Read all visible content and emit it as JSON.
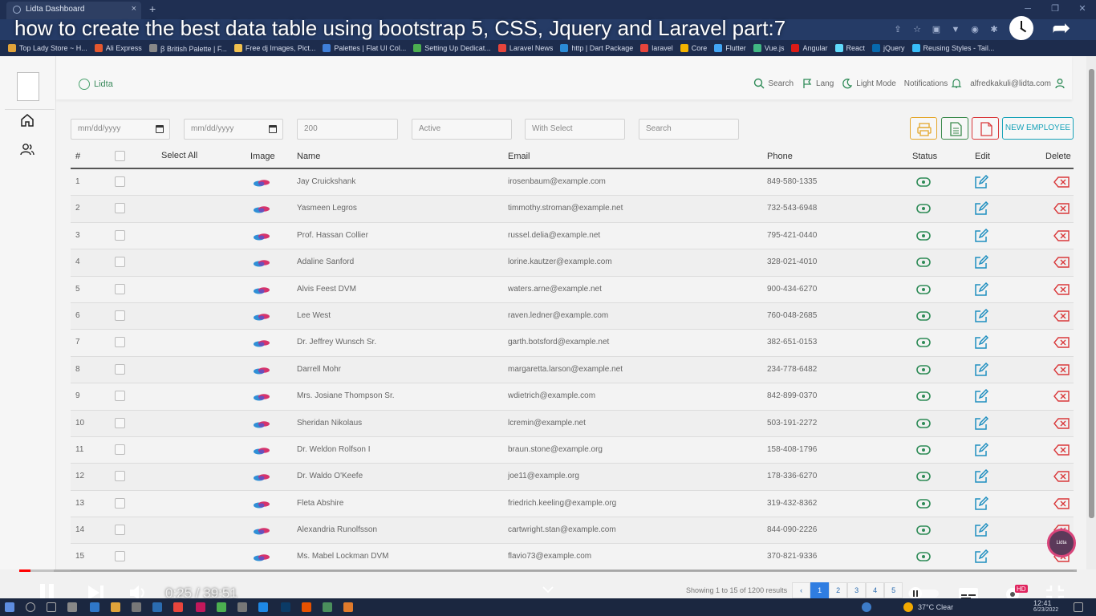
{
  "browser": {
    "tab_title": "Lidta Dashboard",
    "tab_close": "×",
    "new_tab": "+",
    "bookmarks": [
      {
        "label": "Top Lady Store ~ H...",
        "color": "#e1a33a"
      },
      {
        "label": "Ali Express",
        "color": "#e4572e"
      },
      {
        "label": "ꞵ British Palette | F...",
        "color": "#888888"
      },
      {
        "label": "Free dj Images, Pict...",
        "color": "#f2c14e"
      },
      {
        "label": "Palettes | Flat UI Col...",
        "color": "#3f7fd9"
      },
      {
        "label": "Setting Up Dedicat...",
        "color": "#4caf50"
      },
      {
        "label": "Laravel News",
        "color": "#e8453c"
      },
      {
        "label": "http | Dart Package",
        "color": "#2b8bd6"
      },
      {
        "label": "laravel",
        "color": "#e8453c"
      },
      {
        "label": "Core",
        "color": "#f4b400"
      },
      {
        "label": "Flutter",
        "color": "#42a5f5"
      },
      {
        "label": "Vue.js",
        "color": "#41b883"
      },
      {
        "label": "Angular",
        "color": "#dd1b16"
      },
      {
        "label": "React",
        "color": "#61dafb"
      },
      {
        "label": "jQuery",
        "color": "#0769ad"
      },
      {
        "label": "Reusing Styles - Tail...",
        "color": "#38bdf8"
      }
    ]
  },
  "video": {
    "title": "how to create the best data table using bootstrap 5, CSS, Jquery and Laravel part:7",
    "time": "0:25 / 39:51",
    "progress_played": 0.011,
    "progress_loaded": 0.033
  },
  "nav": {
    "brand": "Lidta",
    "search": "Search",
    "lang": "Lang",
    "light_mode": "Light Mode",
    "notifications": "Notifications",
    "email": "alfredkakuli@lidta.com"
  },
  "filters": {
    "date_from": "mm/dd/yyyy",
    "date_to": "mm/dd/yyyy",
    "per_page": "200",
    "status": "Active",
    "select": "With Select",
    "search": "Search",
    "new_employee": "NEW EMPLOYEE"
  },
  "table": {
    "headers": {
      "num": "#",
      "select_all": "Select All",
      "image": "Image",
      "name": "Name",
      "email": "Email",
      "phone": "Phone",
      "status": "Status",
      "edit": "Edit",
      "delete": "Delete"
    },
    "rows": [
      {
        "num": "1",
        "name": "Jay Cruickshank",
        "email": "irosenbaum@example.com",
        "phone": "849-580-1335"
      },
      {
        "num": "2",
        "name": "Yasmeen Legros",
        "email": "timmothy.stroman@example.net",
        "phone": "732-543-6948"
      },
      {
        "num": "3",
        "name": "Prof. Hassan Collier",
        "email": "russel.delia@example.net",
        "phone": "795-421-0440"
      },
      {
        "num": "4",
        "name": "Adaline Sanford",
        "email": "lorine.kautzer@example.com",
        "phone": "328-021-4010"
      },
      {
        "num": "5",
        "name": "Alvis Feest DVM",
        "email": "waters.arne@example.net",
        "phone": "900-434-6270"
      },
      {
        "num": "6",
        "name": "Lee West",
        "email": "raven.ledner@example.com",
        "phone": "760-048-2685"
      },
      {
        "num": "7",
        "name": "Dr. Jeffrey Wunsch Sr.",
        "email": "garth.botsford@example.net",
        "phone": "382-651-0153"
      },
      {
        "num": "8",
        "name": "Darrell Mohr",
        "email": "margaretta.larson@example.net",
        "phone": "234-778-6482"
      },
      {
        "num": "9",
        "name": "Mrs. Josiane Thompson Sr.",
        "email": "wdietrich@example.com",
        "phone": "842-899-0370"
      },
      {
        "num": "10",
        "name": "Sheridan Nikolaus",
        "email": "lcremin@example.net",
        "phone": "503-191-2272"
      },
      {
        "num": "11",
        "name": "Dr. Weldon Rolfson I",
        "email": "braun.stone@example.org",
        "phone": "158-408-1796"
      },
      {
        "num": "12",
        "name": "Dr. Waldo O'Keefe",
        "email": "joe11@example.org",
        "phone": "178-336-6270"
      },
      {
        "num": "13",
        "name": "Fleta Abshire",
        "email": "friedrich.keeling@example.org",
        "phone": "319-432-8362"
      },
      {
        "num": "14",
        "name": "Alexandria Runolfsson",
        "email": "cartwright.stan@example.com",
        "phone": "844-090-2226"
      },
      {
        "num": "15",
        "name": "Ms. Mabel Lockman DVM",
        "email": "flavio73@example.com",
        "phone": "370-821-9336"
      }
    ]
  },
  "pagination": {
    "summary": "Showing 1 to 15 of 1200 results",
    "prev": "‹",
    "pages": [
      "1",
      "2",
      "3",
      "4",
      "5"
    ]
  },
  "taskbar": {
    "weather": "37°C  Clear",
    "clock": "12:41",
    "date": "6/23/2022"
  },
  "fab": {
    "label": "Lidta"
  },
  "colors": {
    "accent": "#17a2b8",
    "status_green": "#2e8b57",
    "edit_blue": "#1f8fc0",
    "delete_red": "#d9383a",
    "print_orange": "#e4a72b",
    "excel_green": "#3b8a4c",
    "pdf_red": "#d9383a"
  }
}
